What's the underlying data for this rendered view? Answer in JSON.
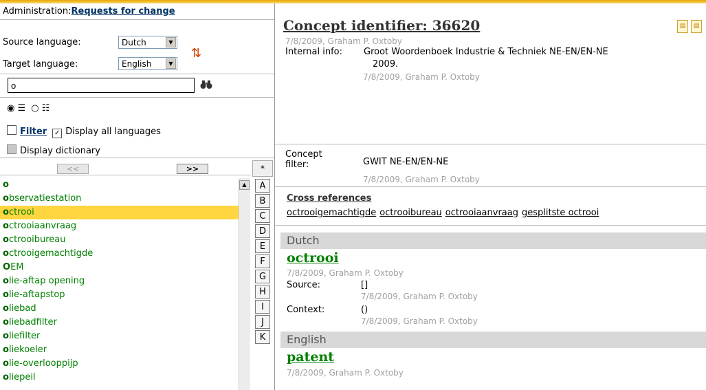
{
  "left": {
    "admin_label": "Administration:",
    "admin_link": "Requests for change",
    "source_label": "Source language:",
    "source_value": "Dutch",
    "target_label": "Target language:",
    "target_value": "English",
    "search_value": "o",
    "filter_label": "Filter",
    "display_all_label": "Display all languages",
    "display_dictionary_label": "Display dictionary",
    "prev_label": "<<",
    "next_label": ">>",
    "star_label": "*",
    "items": [
      {
        "first": "o",
        "rest": ""
      },
      {
        "first": "o",
        "rest": "bservatiestation"
      },
      {
        "first": "o",
        "rest": "ctrooi"
      },
      {
        "first": "o",
        "rest": "ctrooiaanvraag"
      },
      {
        "first": "o",
        "rest": "ctrooibureau"
      },
      {
        "first": "o",
        "rest": "ctrooigemachtigde"
      },
      {
        "first": "O",
        "rest": "EM"
      },
      {
        "first": "o",
        "rest": "lie-aftap opening"
      },
      {
        "first": "o",
        "rest": "lie-aftapstop"
      },
      {
        "first": "o",
        "rest": "liebad"
      },
      {
        "first": "o",
        "rest": "liebadfilter"
      },
      {
        "first": "o",
        "rest": "liefilter"
      },
      {
        "first": "o",
        "rest": "liekoeler"
      },
      {
        "first": "o",
        "rest": "lie-overlooppijp"
      },
      {
        "first": "o",
        "rest": "liepeil"
      }
    ],
    "selected_index": 2,
    "letters": [
      "A",
      "B",
      "C",
      "D",
      "E",
      "F",
      "G",
      "H",
      "I",
      "J",
      "K"
    ]
  },
  "right": {
    "concept_title": "Concept identifier: 36620",
    "concept_meta": "7/8/2009, Graham P. Oxtoby",
    "internal_label": "Internal info:",
    "internal_value_1": "Groot Woordenboek Industrie & Techniek NE-EN/EN-NE",
    "internal_value_2": "2009.",
    "internal_meta": "7/8/2009, Graham P. Oxtoby",
    "concept_filter_label_1": "Concept",
    "concept_filter_label_2": "filter:",
    "concept_filter_value": "GWIT NE-EN/EN-NE",
    "concept_filter_meta": "7/8/2009, Graham P. Oxtoby",
    "cross_title": "Cross references",
    "cross_links": [
      "octrooigemachtigde",
      "octrooibureau",
      "octrooiaanvraag",
      "gesplitste octrooi"
    ],
    "dutch": {
      "lang": "Dutch",
      "term": "octrooi",
      "meta": "7/8/2009, Graham P. Oxtoby",
      "source_label": "Source:",
      "source_value": "[]",
      "source_meta": "7/8/2009, Graham P. Oxtoby",
      "context_label": "Context:",
      "context_value": "()",
      "context_meta": "7/8/2009, Graham P. Oxtoby"
    },
    "english": {
      "lang": "English",
      "term": "patent",
      "meta": "7/8/2009, Graham P. Oxtoby"
    }
  }
}
